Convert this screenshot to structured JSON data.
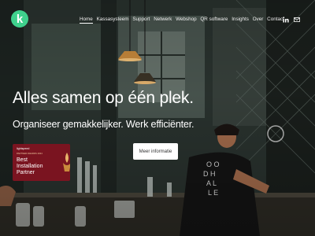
{
  "brand": {
    "logo_letter": "k",
    "logo_color": "#3fd18d"
  },
  "nav": {
    "items": [
      {
        "label": "Home",
        "active": true
      },
      {
        "label": "Kassasysteem",
        "active": false
      },
      {
        "label": "Support",
        "active": false
      },
      {
        "label": "Netwerk",
        "active": false
      },
      {
        "label": "Webshop",
        "active": false
      },
      {
        "label": "QR software",
        "active": false
      },
      {
        "label": "Insights",
        "active": false
      },
      {
        "label": "Over",
        "active": false
      },
      {
        "label": "Contact",
        "active": false
      }
    ],
    "icons": [
      "linkedin-icon",
      "mail-icon"
    ]
  },
  "hero": {
    "headline": "Alles samen op één plek.",
    "subline": "Organiseer gemakkelijker. Werk efficiënter.",
    "cta_label": "Meer informatie"
  },
  "award": {
    "brand": "lightspeed",
    "sub": "PARTNER AWARDS 2024",
    "line1": "Best",
    "line2": "Installation",
    "line3": "Partner",
    "color": "#7a1420"
  }
}
